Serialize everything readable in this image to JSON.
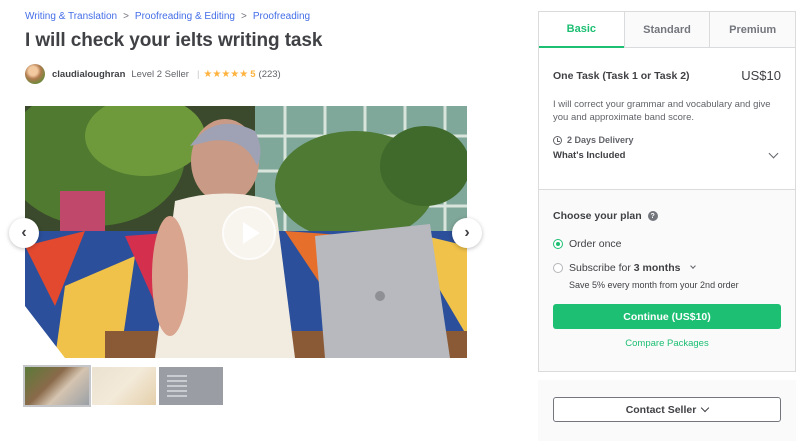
{
  "breadcrumb": {
    "items": [
      "Writing & Translation",
      "Proofreading & Editing",
      "Proofreading"
    ],
    "separator": ">"
  },
  "gig": {
    "title": "I will check your ielts writing task"
  },
  "seller": {
    "name": "claudialoughran",
    "level": "Level 2 Seller",
    "separator": "|",
    "stars": "★★★★★",
    "rating": "5",
    "reviews": "(223)"
  },
  "media": {
    "prev_icon": "chevron-left-icon",
    "next_icon": "chevron-right-icon",
    "play_icon": "play-icon",
    "prev_glyph": "‹",
    "next_glyph": "›"
  },
  "packages": {
    "tabs": [
      "Basic",
      "Standard",
      "Premium"
    ],
    "active_tab": "Basic",
    "name": "One Task (Task 1 or Task 2)",
    "price": "US$10",
    "description": "I will correct your grammar and vocabulary and give you and approximate band score.",
    "delivery": "2 Days Delivery",
    "whats_included": "What's Included"
  },
  "plan": {
    "title": "Choose your plan",
    "help_glyph": "?",
    "option_once": "Order once",
    "option_subscribe_prefix": "Subscribe for ",
    "option_subscribe_duration": "3 months",
    "save_note": "Save 5% every month from your 2nd order",
    "continue_label": "Continue (US$10)",
    "compare_label": "Compare Packages"
  },
  "contact": {
    "label": "Contact Seller"
  },
  "colors": {
    "accent": "#1dbf73",
    "link": "#446ee7",
    "star": "#ffb33e",
    "text": "#404145"
  }
}
